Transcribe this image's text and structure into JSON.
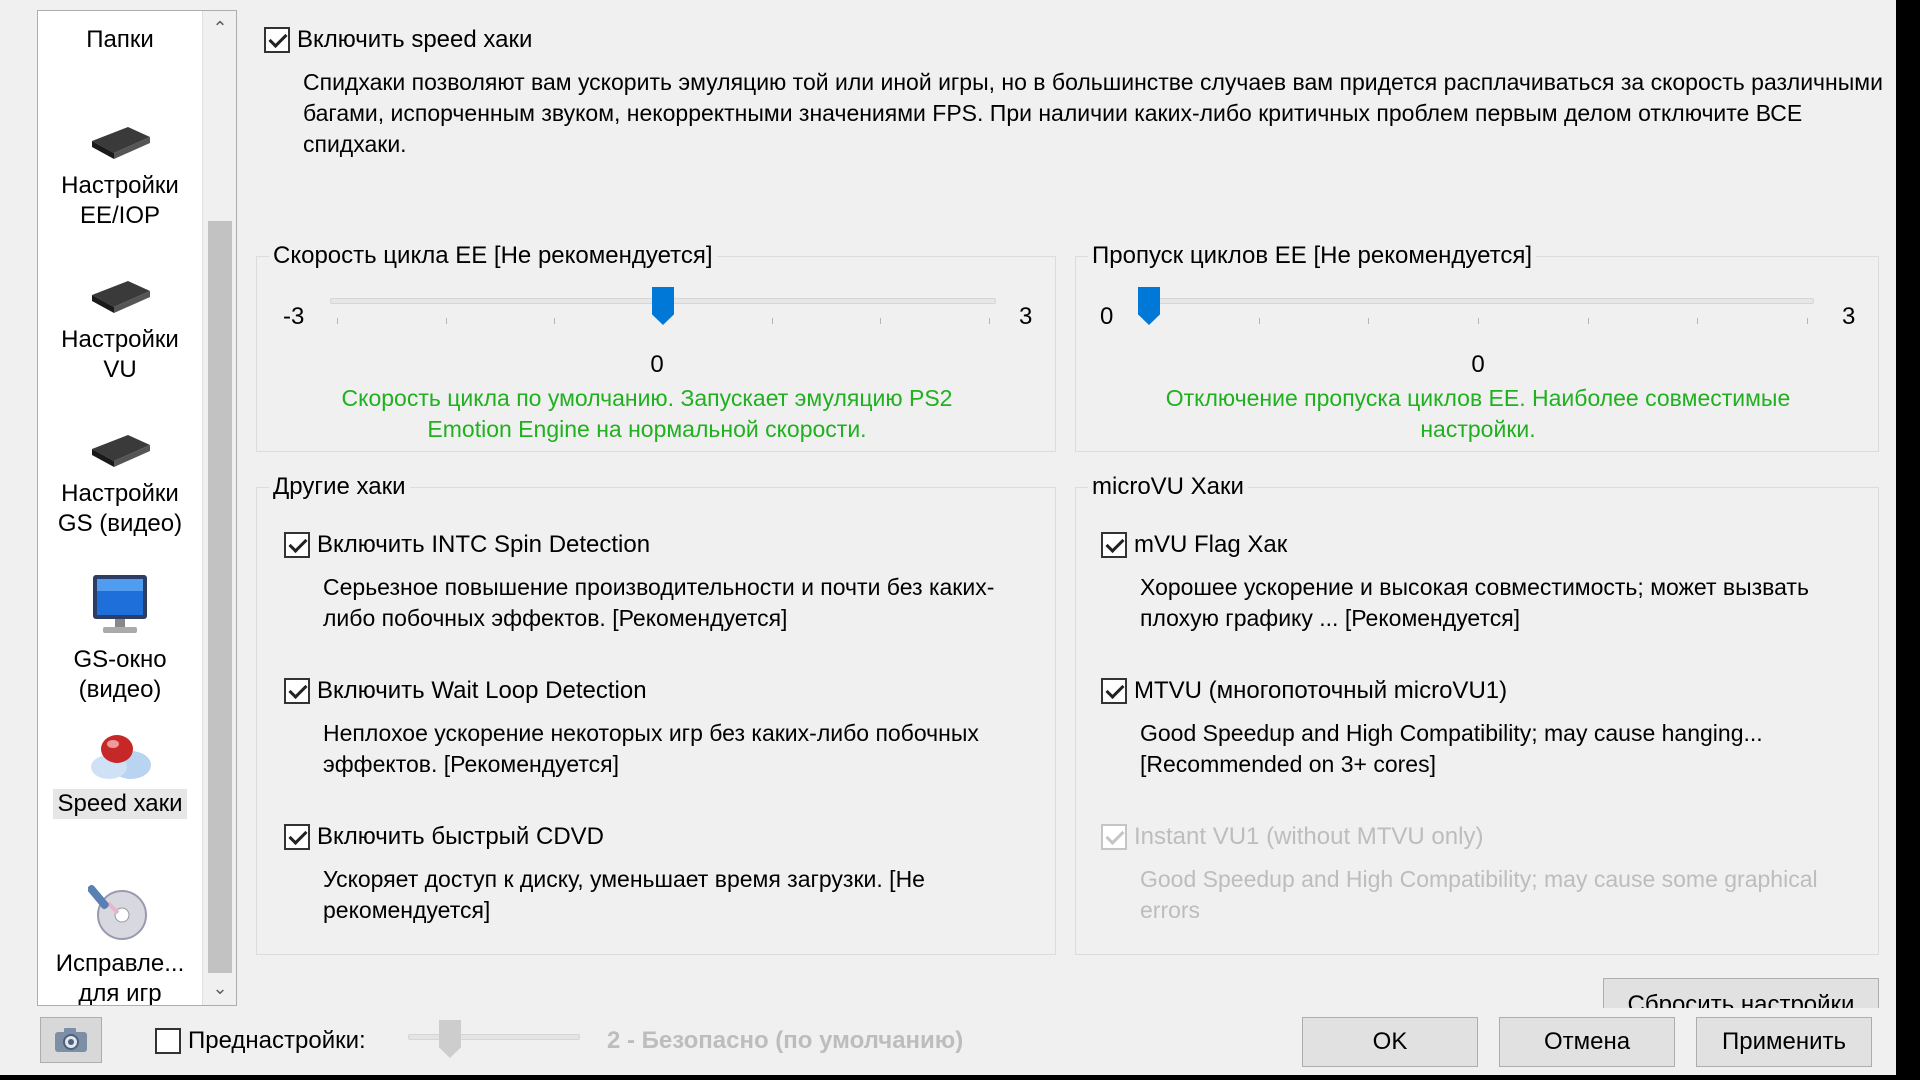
{
  "sidebar": {
    "header": "Папки",
    "items": [
      {
        "label_line1": "Настройки",
        "label_line2": "EE/IOP",
        "icon": "chip-icon"
      },
      {
        "label_line1": "Настройки",
        "label_line2": "VU",
        "icon": "chip-icon"
      },
      {
        "label_line1": "Настройки",
        "label_line2": "GS (видео)",
        "icon": "chip-icon"
      },
      {
        "label_line1": "GS-окно",
        "label_line2": "(видео)",
        "icon": "monitor-icon"
      },
      {
        "label_line1": "Speed хаки",
        "label_line2": "",
        "icon": "pill-icon",
        "selected": true
      },
      {
        "label_line1": "Исправле...",
        "label_line2": "для игр",
        "icon": "disc-icon"
      }
    ]
  },
  "main": {
    "enable_checkbox_label": "Включить speed хаки",
    "enable_checked": true,
    "description": "Спидхаки позволяют вам ускорить эмуляцию той или иной игры, но в большинстве случаев вам придется расплачиваться за скорость различными багами, испорченным звуком, некорректными значениями FPS. При наличии каких-либо критичных проблем первым делом отключите ВСЕ спидхаки."
  },
  "ee_cyclerate": {
    "title": "Скорость цикла EE [Не рекомендуется]",
    "min_label": "-3",
    "max_label": "3",
    "min": -3,
    "max": 3,
    "value": 0,
    "value_label": "0",
    "description": "Скорость цикла по умолчанию. Запускает эмуляцию PS2 Emotion Engine на нормальной скорости."
  },
  "ee_cycleskip": {
    "title": "Пропуск циклов EE [Не рекомендуется]",
    "min_label": "0",
    "max_label": "3",
    "min": 0,
    "max": 3,
    "value": 0,
    "value_label": "0",
    "description": "Отключение пропуска циклов EE. Наиболее совместимые настройки."
  },
  "other_hacks": {
    "title": "Другие хаки",
    "items": [
      {
        "label": "Включить INTC Spin Detection",
        "checked": true,
        "description": "Серьезное повышение производительности и почти без каких-либо побочных эффектов. [Рекомендуется]"
      },
      {
        "label": "Включить Wait Loop Detection",
        "checked": true,
        "description": "Неплохое ускорение некоторых игр без каких-либо побочных эффектов. [Рекомендуется]"
      },
      {
        "label": "Включить быстрый CDVD",
        "checked": true,
        "description": "Ускоряет доступ к диску, уменьшает время загрузки. [Не рекомендуется]"
      }
    ]
  },
  "microvu_hacks": {
    "title": "microVU Хаки",
    "items": [
      {
        "label": "mVU Flag Хак",
        "checked": true,
        "disabled": false,
        "description": "Хорошее ускорение и высокая совместимость; может вызвать плохую графику ... [Рекомендуется]"
      },
      {
        "label": "MTVU (многопоточный microVU1)",
        "checked": true,
        "disabled": false,
        "description": "Good Speedup and High Compatibility; may cause hanging... [Recommended on 3+ cores]"
      },
      {
        "label": "Instant VU1 (without MTVU only)",
        "checked": true,
        "disabled": true,
        "description": "Good Speedup and High Compatibility; may cause some graphical errors"
      }
    ]
  },
  "reset_button": "Сбросить настройки",
  "footer": {
    "presets_label": "Преднастройки:",
    "presets_checked": false,
    "preset_value_text": "2 - Безопасно (по умолчанию)",
    "ok": "OK",
    "cancel": "Отмена",
    "apply": "Применить"
  },
  "colors": {
    "accent": "#0078d7",
    "green_text": "#20b020",
    "disabled_text": "#bdbdbd",
    "window_bg": "#f0f0f0"
  }
}
